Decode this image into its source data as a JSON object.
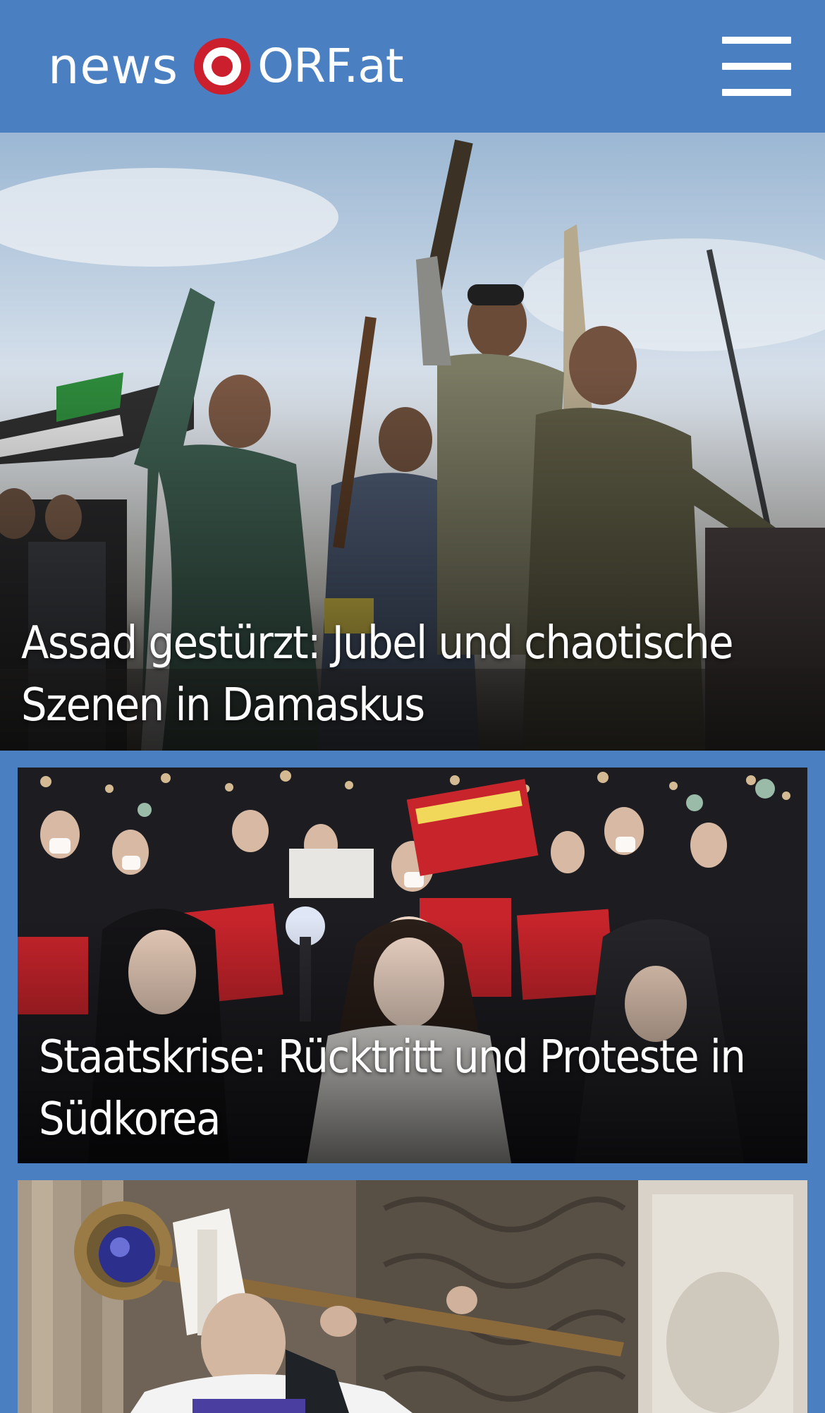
{
  "header": {
    "logo_news": "news",
    "logo_orf": "ORF.at",
    "menu_icon": "hamburger-menu-icon"
  },
  "colors": {
    "brand_blue": "#4a80c2",
    "logo_red": "#cc1f2d",
    "headline_text": "#ffffff"
  },
  "stories": [
    {
      "headline": "Assad gestürzt: Jubel und chaotische Szenen in Damaskus",
      "image": "syria-celebration-photo"
    },
    {
      "headline": "Staatskrise: Rücktritt und Proteste in Südkorea",
      "image": "south-korea-protest-photo"
    },
    {
      "headline": "",
      "image": "bishop-crozier-photo"
    }
  ]
}
